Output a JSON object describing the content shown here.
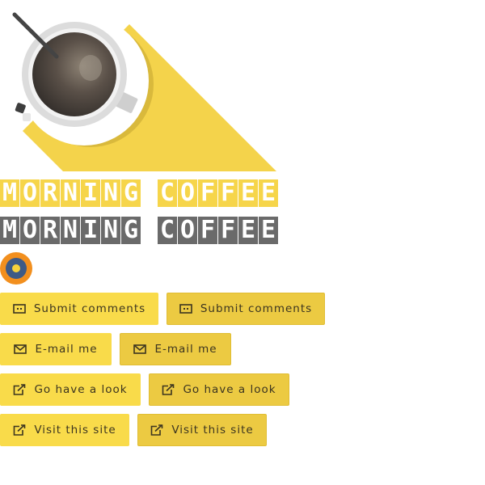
{
  "title": {
    "text": "MORNING COFFEE"
  },
  "buttons": [
    {
      "label": "Submit comments",
      "icon": "comment-icon"
    },
    {
      "label": "E-mail me",
      "icon": "envelope-icon"
    },
    {
      "label": "Go have a look",
      "icon": "external-link-icon"
    },
    {
      "label": "Visit this site",
      "icon": "external-link-icon"
    }
  ],
  "colors": {
    "accent_yellow": "#f6d54a",
    "button_light": "#f9db4a",
    "button_dark": "#ecca42",
    "title_gray": "#6a6a6a",
    "badge_orange": "#f28f1e",
    "badge_blue": "#3e5a86"
  }
}
